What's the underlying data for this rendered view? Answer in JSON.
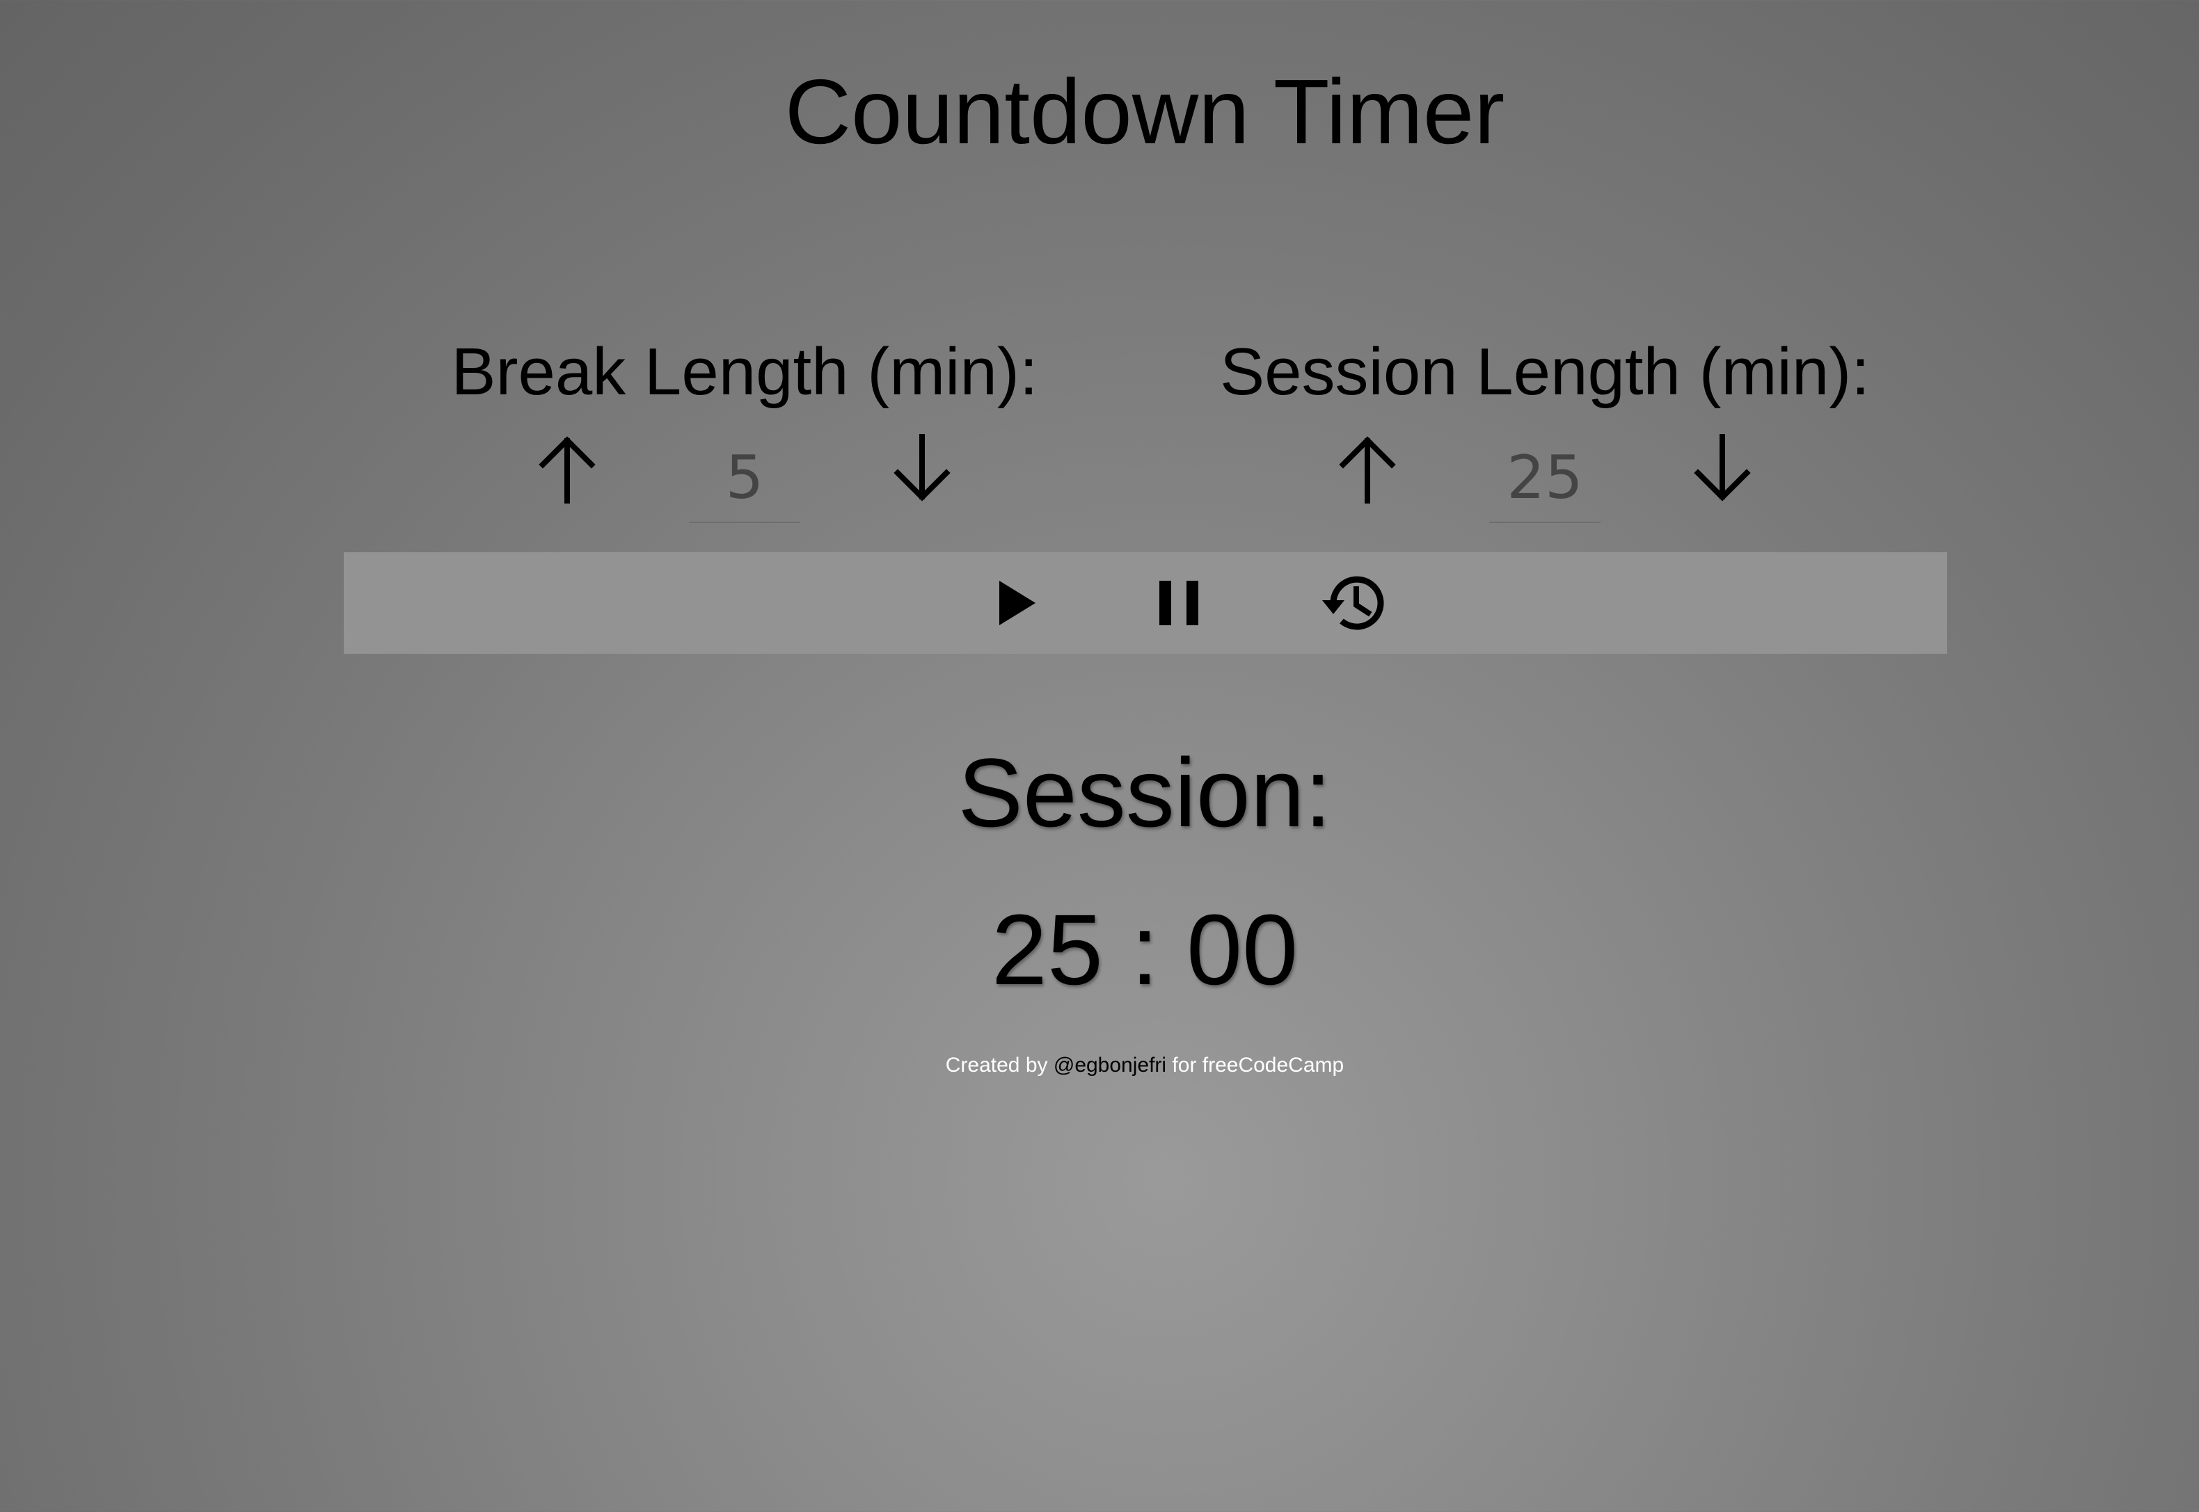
{
  "app": {
    "title": "Countdown Timer"
  },
  "controls": {
    "break": {
      "label": "Break Length (min):",
      "value": "5",
      "increment_icon": "arrow-up-icon",
      "decrement_icon": "arrow-down-icon"
    },
    "session": {
      "label": "Session Length (min):",
      "value": "25",
      "increment_icon": "arrow-up-icon",
      "decrement_icon": "arrow-down-icon"
    }
  },
  "toolbar": {
    "play_icon": "play-icon",
    "pause_icon": "pause-icon",
    "reset_icon": "history-icon"
  },
  "timer": {
    "state_label": "Session:",
    "time": "25 : 00"
  },
  "footer": {
    "prefix": "Created by",
    "author": "@egbonjefri",
    "suffix": "for freeCodeCamp"
  },
  "colors": {
    "toolbar_bg": "#939393",
    "footer_text": "#ffffff",
    "value_text": "#444444"
  }
}
